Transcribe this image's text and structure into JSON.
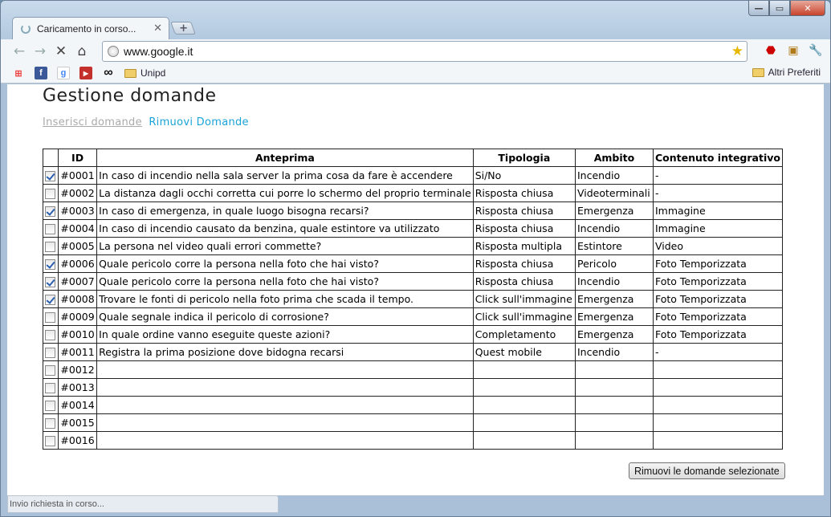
{
  "browser": {
    "tab_title": "Caricamento in corso...",
    "url": "www.google.it",
    "bookmarks": [
      {
        "icon": "windows-icon"
      },
      {
        "icon": "facebook-icon"
      },
      {
        "icon": "google-icon"
      },
      {
        "icon": "youtube-icon"
      },
      {
        "icon": "infinity-icon"
      }
    ],
    "bookmark_folder": "Unipd",
    "other_bookmarks": "Altri Preferiti",
    "status": "Invio richiesta in corso..."
  },
  "page": {
    "title": "Gestione domande",
    "link_insert": "Inserisci domande",
    "link_remove": "Rimuovi Domande",
    "remove_button": "Rimuovi le domande selezionate"
  },
  "table": {
    "headers": [
      "ID",
      "Anteprima",
      "Tipologia",
      "Ambito",
      "Contenuto integrativo"
    ],
    "rows": [
      {
        "checked": true,
        "id": "#0001",
        "preview": "In caso di incendio nella sala server la prima cosa da fare è accendere",
        "type": "Si/No",
        "scope": "Incendio",
        "extra": "-"
      },
      {
        "checked": false,
        "id": "#0002",
        "preview": "La distanza dagli occhi corretta cui porre lo schermo del proprio terminale",
        "type": "Risposta chiusa",
        "scope": "Videoterminali",
        "extra": "-"
      },
      {
        "checked": true,
        "id": "#0003",
        "preview": "In caso di emergenza, in quale luogo bisogna recarsi?",
        "type": "Risposta chiusa",
        "scope": "Emergenza",
        "extra": "Immagine"
      },
      {
        "checked": false,
        "id": "#0004",
        "preview": "In caso di incendio causato da benzina, quale estintore va utilizzato",
        "type": "Risposta chiusa",
        "scope": "Incendio",
        "extra": "Immagine"
      },
      {
        "checked": false,
        "id": "#0005",
        "preview": "La persona nel video quali errori commette?",
        "type": "Risposta multipla",
        "scope": "Estintore",
        "extra": "Video"
      },
      {
        "checked": true,
        "id": "#0006",
        "preview": "Quale pericolo corre la persona nella foto che hai visto?",
        "type": "Risposta chiusa",
        "scope": "Pericolo",
        "extra": "Foto Temporizzata"
      },
      {
        "checked": true,
        "id": "#0007",
        "preview": "Quale pericolo corre la persona nella foto che hai visto?",
        "type": "Risposta chiusa",
        "scope": "Incendio",
        "extra": "Foto Temporizzata"
      },
      {
        "checked": true,
        "id": "#0008",
        "preview": "Trovare le fonti di pericolo nella foto prima che scada il tempo.",
        "type": "Click sull'immagine",
        "scope": "Emergenza",
        "extra": "Foto Temporizzata"
      },
      {
        "checked": false,
        "id": "#0009",
        "preview": "Quale segnale indica il pericolo di corrosione?",
        "type": "Click sull'immagine",
        "scope": "Emergenza",
        "extra": "Foto Temporizzata"
      },
      {
        "checked": false,
        "id": "#0010",
        "preview": "In quale ordine vanno eseguite queste azioni?",
        "type": "Completamento",
        "scope": "Emergenza",
        "extra": "Foto Temporizzata"
      },
      {
        "checked": false,
        "id": "#0011",
        "preview": "Registra la prima posizione dove bidogna recarsi",
        "type": "Quest mobile",
        "scope": "Incendio",
        "extra": "-"
      },
      {
        "checked": false,
        "id": "#0012",
        "preview": "",
        "type": "",
        "scope": "",
        "extra": ""
      },
      {
        "checked": false,
        "id": "#0013",
        "preview": "",
        "type": "",
        "scope": "",
        "extra": ""
      },
      {
        "checked": false,
        "id": "#0014",
        "preview": "",
        "type": "",
        "scope": "",
        "extra": ""
      },
      {
        "checked": false,
        "id": "#0015",
        "preview": "",
        "type": "",
        "scope": "",
        "extra": ""
      },
      {
        "checked": false,
        "id": "#0016",
        "preview": "",
        "type": "",
        "scope": "",
        "extra": ""
      }
    ]
  }
}
